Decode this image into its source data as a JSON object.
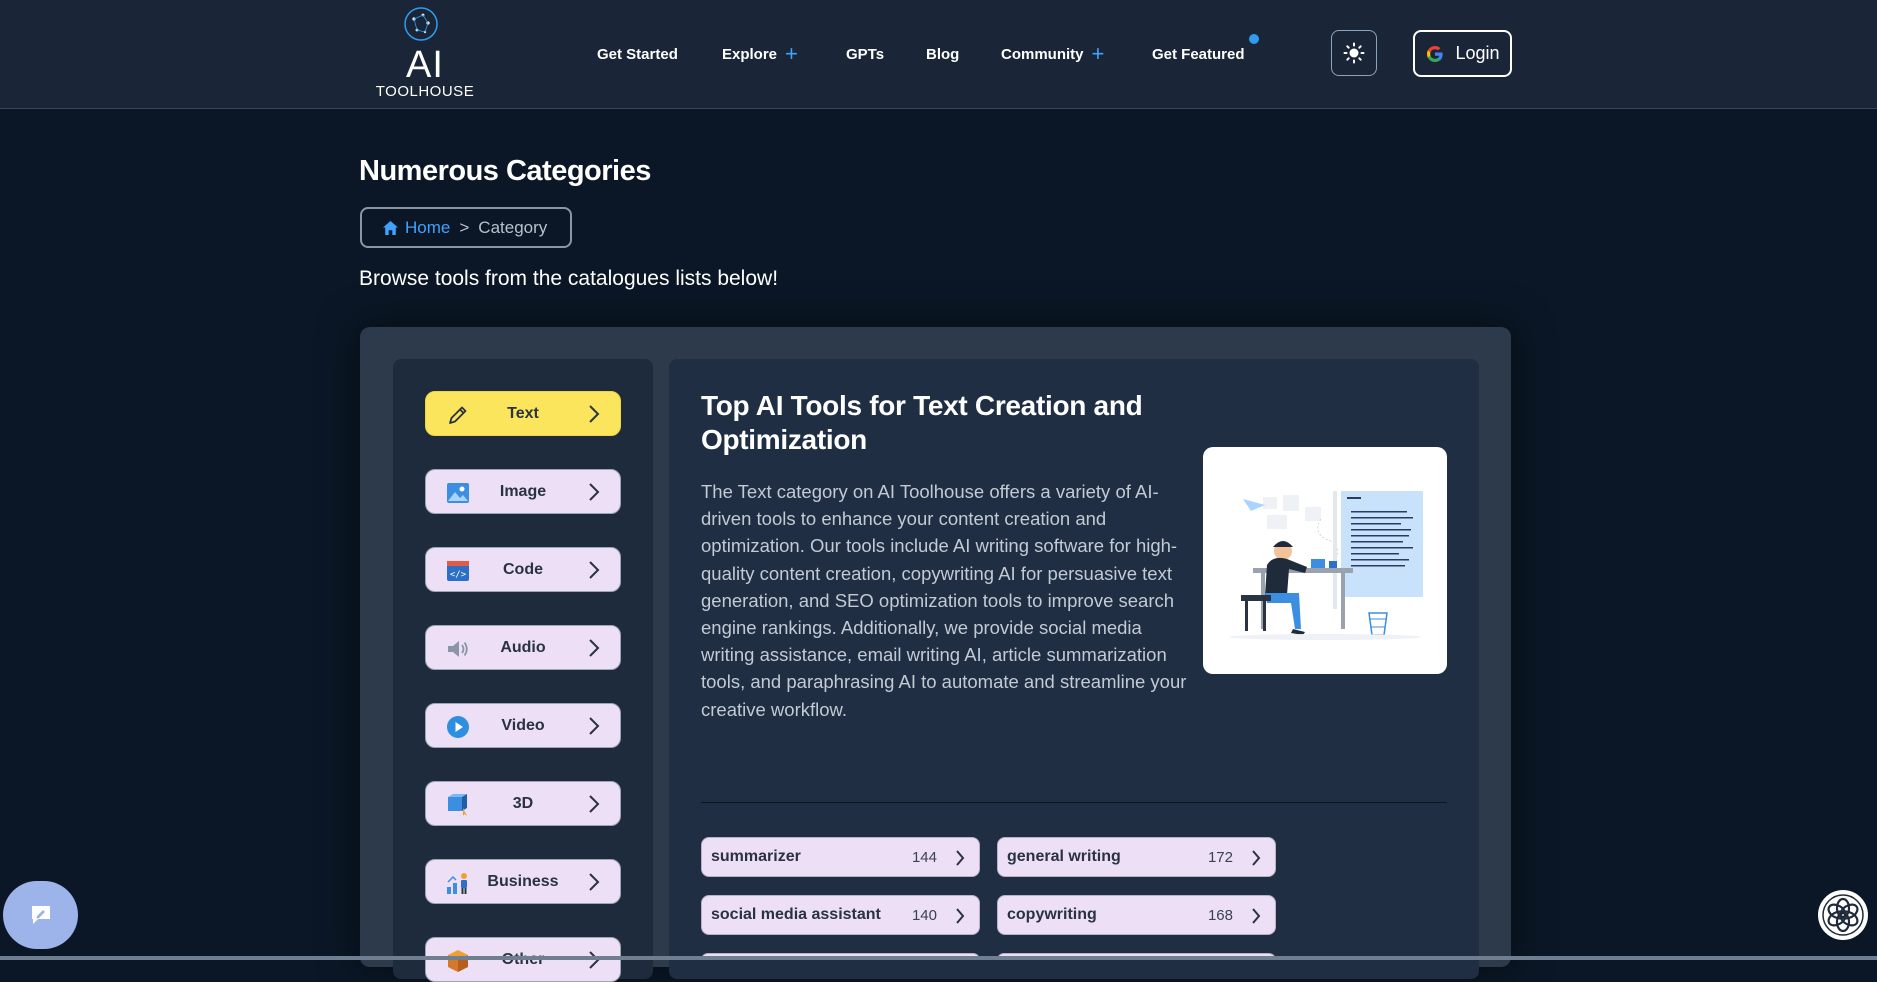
{
  "brand": {
    "logo_main": "AI",
    "logo_sub": "TOOLHOUSE"
  },
  "nav": {
    "items": [
      {
        "label": "Get Started",
        "has_plus": false
      },
      {
        "label": "Explore",
        "has_plus": true
      },
      {
        "label": "GPTs",
        "has_plus": false
      },
      {
        "label": "Blog",
        "has_plus": false
      },
      {
        "label": "Community",
        "has_plus": true
      },
      {
        "label": "Get Featured",
        "has_plus": false
      }
    ],
    "login_label": "Login"
  },
  "page": {
    "title": "Numerous Categories",
    "breadcrumb": {
      "home": "Home",
      "separator": ">",
      "current": "Category"
    },
    "subtitle": "Browse tools from the catalogues lists below!"
  },
  "categories": [
    {
      "label": "Text",
      "icon": "pencil-icon",
      "active": true
    },
    {
      "label": "Image",
      "icon": "image-icon",
      "active": false
    },
    {
      "label": "Code",
      "icon": "code-icon",
      "active": false
    },
    {
      "label": "Audio",
      "icon": "speaker-icon",
      "active": false
    },
    {
      "label": "Video",
      "icon": "play-icon",
      "active": false
    },
    {
      "label": "3D",
      "icon": "cube-icon",
      "active": false
    },
    {
      "label": "Business",
      "icon": "business-icon",
      "active": false
    },
    {
      "label": "Other",
      "icon": "box-icon",
      "active": false
    }
  ],
  "content": {
    "title": "Top AI Tools for Text Creation and Optimization",
    "description": "The Text category on AI Toolhouse offers a variety of AI-driven tools to enhance your content creation and optimization. Our tools include AI writing software for high-quality content creation, copywriting AI for persuasive text generation, and SEO optimization tools to improve search engine rankings. Additionally, we provide social media writing assistance, email writing AI, article summarization tools, and paraphrasing AI to automate and streamline your creative workflow."
  },
  "tags": [
    {
      "name": "summarizer",
      "count": "144"
    },
    {
      "name": "general writing",
      "count": "172"
    },
    {
      "name": "social media assistant",
      "count": "140"
    },
    {
      "name": "copywriting",
      "count": "168"
    }
  ],
  "colors": {
    "background": "#0b1726",
    "header": "#1a2637",
    "accent_blue": "#3fa2ff",
    "active_category": "#fbe55c",
    "category_button": "#ecdff6"
  }
}
